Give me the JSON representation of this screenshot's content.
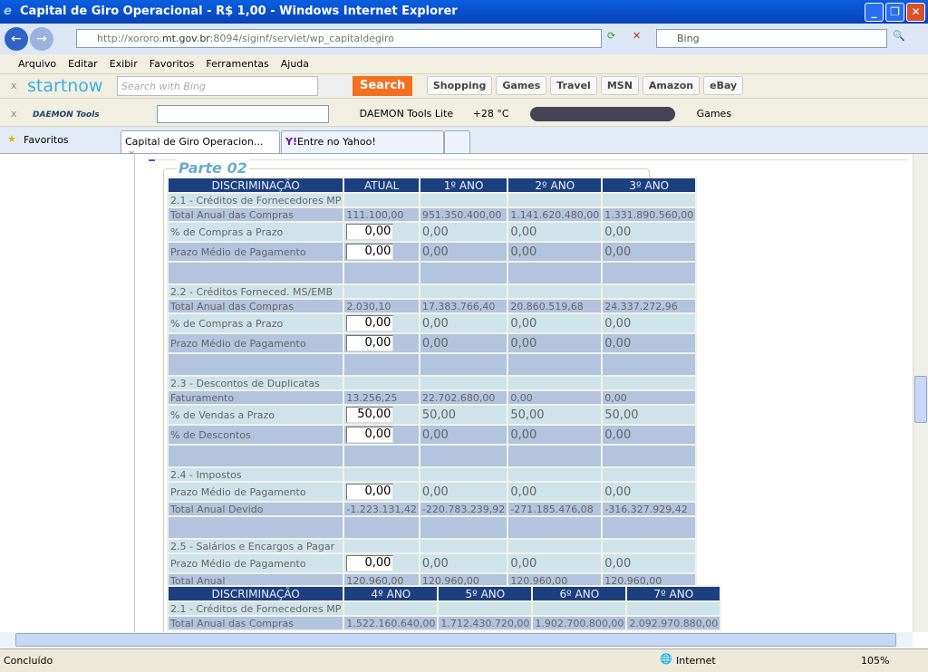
{
  "window": {
    "title": "Capital de Giro Operacional - R$ 1,00 - Windows Internet Explorer"
  },
  "address": {
    "url_prefix": "http://xororo.",
    "url_domain": "mt.gov.br",
    "url_suffix": ":8094/siginf/servlet/wp_capitaldegiro",
    "search_placeholder": "Bing"
  },
  "menu": [
    "Arquivo",
    "Editar",
    "Exibir",
    "Favoritos",
    "Ferramentas",
    "Ajuda"
  ],
  "startnow": {
    "logo": "startnow",
    "search_placeholder": "Search with Bing",
    "search_button": "Search",
    "links": [
      "Shopping",
      "Games",
      "Travel",
      "MSN",
      "Amazon",
      "eBay"
    ]
  },
  "daemon": {
    "logo": "DAEMON Tools",
    "tool": "DAEMON Tools Lite",
    "weather": "+28 °C",
    "games": "Games"
  },
  "favorites": {
    "label": "Favoritos",
    "tabs": [
      "Capital de Giro Operacion...",
      "Entre no Yahoo!"
    ]
  },
  "page": {
    "legend": "Parte 02",
    "headers1": [
      "DISCRIMINAÇÃO",
      "ATUAL",
      "1º ANO",
      "2º ANO",
      "3º ANO"
    ],
    "rows1": [
      {
        "t": "lbl",
        "c": [
          "2.1 - Créditos de Fornecedores MP",
          "",
          "",
          "",
          ""
        ]
      },
      {
        "t": "tot",
        "c": [
          "Total Anual das Compras",
          "111.100,00",
          "951.350.400,00",
          "1.141.620.480,00",
          "1.331.890.560,00"
        ]
      },
      {
        "t": "inp l",
        "c": [
          "% de Compras a Prazo",
          "0,00",
          "0,00",
          "0,00",
          "0,00"
        ]
      },
      {
        "t": "inp d",
        "c": [
          "Prazo Médio de Pagamento",
          "0,00",
          "0,00",
          "0,00",
          "0,00"
        ]
      },
      {
        "t": "blank",
        "c": [
          "",
          "",
          "",
          "",
          ""
        ]
      },
      {
        "t": "lbl",
        "c": [
          "2.2 - Créditos Forneced. MS/EMB",
          "",
          "",
          "",
          ""
        ]
      },
      {
        "t": "tot",
        "c": [
          "Total Anual das Compras",
          "2.030,10",
          "17.383.766,40",
          "20.860.519,68",
          "24.337.272,96"
        ]
      },
      {
        "t": "inp l",
        "c": [
          "% de Compras a Prazo",
          "0,00",
          "0,00",
          "0,00",
          "0,00"
        ]
      },
      {
        "t": "inp d",
        "c": [
          "Prazo Médio de Pagamento",
          "0,00",
          "0,00",
          "0,00",
          "0,00"
        ]
      },
      {
        "t": "blank",
        "c": [
          "",
          "",
          "",
          "",
          ""
        ]
      },
      {
        "t": "lbl",
        "c": [
          "2.3 - Descontos de Duplicatas",
          "",
          "",
          "",
          ""
        ]
      },
      {
        "t": "tot",
        "c": [
          "Faturamento",
          "13.256,25",
          "22.702.680,00",
          "0,00",
          "0,00"
        ]
      },
      {
        "t": "inp l",
        "c": [
          "% de Vendas a Prazo",
          "50,00",
          "50,00",
          "50,00",
          "50,00"
        ]
      },
      {
        "t": "inp d",
        "c": [
          "% de Descontos",
          "0,00",
          "0,00",
          "0,00",
          "0,00"
        ]
      },
      {
        "t": "blank",
        "c": [
          "",
          "",
          "",
          "",
          ""
        ]
      },
      {
        "t": "lbl",
        "c": [
          "2.4 - Impostos",
          "",
          "",
          "",
          ""
        ]
      },
      {
        "t": "inp l",
        "c": [
          "Prazo Médio de Pagamento",
          "0,00",
          "0,00",
          "0,00",
          "0,00"
        ]
      },
      {
        "t": "tot",
        "c": [
          "Total Anual Devido",
          "-1.223.131,42",
          "-220.783.239,92",
          "-271.185.476,08",
          "-316.327.929,42"
        ]
      },
      {
        "t": "blank",
        "c": [
          "",
          "",
          "",
          "",
          ""
        ]
      },
      {
        "t": "lbl",
        "c": [
          "2.5 - Salários e Encargos a Pagar",
          "",
          "",
          "",
          ""
        ]
      },
      {
        "t": "inp l",
        "c": [
          "Prazo Médio de Pagamento",
          "0,00",
          "0,00",
          "0,00",
          "0,00"
        ]
      },
      {
        "t": "tot",
        "c": [
          "Total Anual",
          "120.960,00",
          "120.960,00",
          "120.960,00",
          "120.960,00"
        ]
      }
    ],
    "headers2": [
      "DISCRIMINAÇÃO",
      "4º ANO",
      "5º ANO",
      "6º ANO",
      "7º ANO"
    ],
    "rows2": [
      {
        "t": "lbl",
        "c": [
          "2.1 - Créditos de Fornecedores MP",
          "",
          "",
          "",
          ""
        ]
      },
      {
        "t": "tot",
        "c": [
          "Total Anual das Compras",
          "1.522.160.640,00",
          "1.712.430.720,00",
          "1.902.700.800,00",
          "2.092.970.880,00"
        ]
      }
    ]
  },
  "status": {
    "text": "Concluído",
    "zone": "Internet",
    "zoom": "105%"
  }
}
